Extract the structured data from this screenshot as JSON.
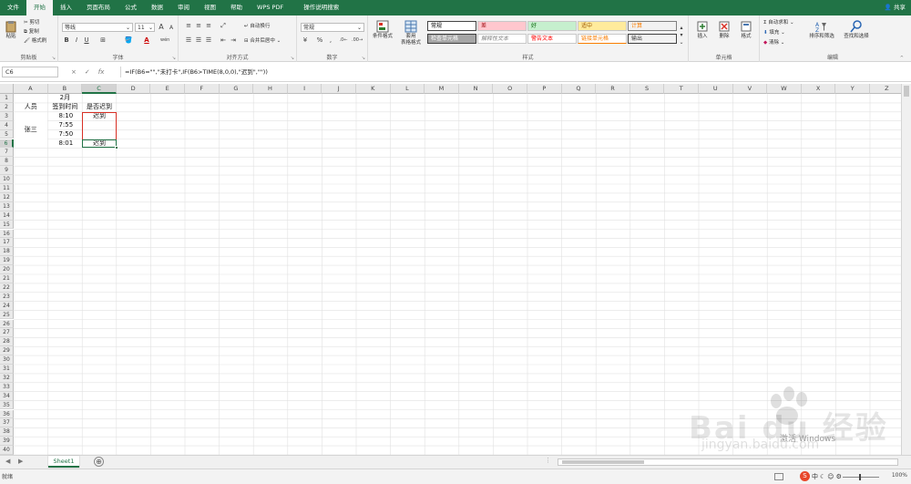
{
  "menu": {
    "tabs": [
      "文件",
      "开始",
      "插入",
      "页面布局",
      "公式",
      "数据",
      "审阅",
      "视图",
      "帮助",
      "WPS PDF",
      "操作说明搜索"
    ],
    "active_index": 1,
    "share": "共享"
  },
  "ribbon": {
    "clipboard": {
      "label": "剪贴板",
      "paste": "粘贴",
      "cut": "剪切",
      "copy": "复制",
      "format_painter": "格式刷"
    },
    "font": {
      "label": "字体",
      "font_name": "等线",
      "font_size": "11",
      "bold": "B",
      "italic": "I",
      "underline": "U",
      "grow": "A",
      "shrink": "A",
      "wen": "wén",
      "font_color": "A"
    },
    "alignment": {
      "label": "对齐方式",
      "wrap": "自动换行",
      "merge": "合并后居中"
    },
    "number": {
      "label": "数字",
      "format": "常规",
      "percent": "%",
      "comma": ","
    },
    "styles": {
      "label": "样式",
      "conditional": "条件格式",
      "table_format_1": "套用",
      "table_format_2": "表格格式",
      "cell_styles": [
        "常规",
        "差",
        "好",
        "适中",
        "计算",
        "检查单元格",
        "解释性文本",
        "警告文本",
        "链接单元格",
        "输出"
      ]
    },
    "cells": {
      "label": "单元格",
      "insert": "插入",
      "delete": "删除",
      "format": "格式"
    },
    "editing": {
      "label": "编辑",
      "autosum": "自动求和",
      "fill": "填充",
      "clear": "清除",
      "sort_filter": "排序和筛选",
      "find_select": "查找和选择"
    }
  },
  "formula_bar": {
    "name_box": "C6",
    "cancel": "×",
    "enter": "✓",
    "fx": "fx",
    "formula": "=IF(B6=\"\",\"未打卡\",IF(B6>TIME(8,0,0),\"迟到\",\"\"))"
  },
  "grid": {
    "columns": [
      "A",
      "B",
      "C",
      "D",
      "E",
      "F",
      "G",
      "H",
      "I",
      "J",
      "K",
      "L",
      "M",
      "N",
      "O",
      "P",
      "Q",
      "R",
      "S",
      "T",
      "U",
      "V",
      "W",
      "X",
      "Y",
      "Z"
    ],
    "rows": [
      "1",
      "2",
      "3",
      "4",
      "5",
      "6",
      "7",
      "8",
      "9",
      "10",
      "11",
      "12",
      "13",
      "14",
      "15",
      "16",
      "17",
      "18",
      "19",
      "20",
      "21",
      "22",
      "23",
      "24",
      "25",
      "26",
      "27",
      "28",
      "29",
      "30",
      "31",
      "32",
      "33",
      "34",
      "35",
      "36",
      "37",
      "38",
      "39",
      "40"
    ],
    "cells": {
      "B1": "2月",
      "A2": "人员",
      "B2": "签到时间",
      "C2": "是否迟到",
      "A4": "张三",
      "B3": "8:10",
      "C3": "迟到",
      "B4": "7:55",
      "B5": "7:50",
      "B6": "8:01",
      "C6": "迟到"
    }
  },
  "sheets": {
    "tabs": [
      "Sheet1"
    ],
    "add": "⊕"
  },
  "status": {
    "mode": "就绪",
    "zoom": "100%"
  },
  "taskbar_ime": {
    "lang": "中"
  },
  "watermark": {
    "brand": "Bai du 经验",
    "url": "jingyan.baidu.com",
    "windows": "激活 Windows"
  },
  "colors": {
    "accent": "#217346",
    "selection_border": "#d93025",
    "bad_bg": "#ffc7ce",
    "bad_fg": "#9c0006",
    "good_bg": "#c6efce",
    "good_fg": "#006100",
    "neutral_bg": "#ffeb9c",
    "neutral_fg": "#9c5700",
    "calc_bg": "#f2f2f2",
    "calc_fg": "#fa7d00",
    "check_bg": "#a5a5a5"
  }
}
